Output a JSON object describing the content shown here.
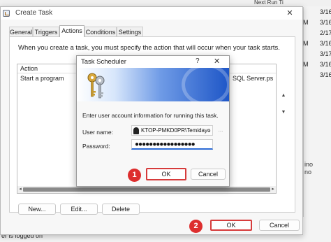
{
  "background": {
    "next_run_header": "Next Run Ti",
    "rows": [
      {
        "marker": "",
        "value": "3/16"
      },
      {
        "marker": "M",
        "value": "3/16"
      },
      {
        "marker": "",
        "value": "2/17"
      },
      {
        "marker": "M",
        "value": "3/16"
      },
      {
        "marker": "",
        "value": "3/17"
      },
      {
        "marker": "M",
        "value": "3/16"
      },
      {
        "marker": "",
        "value": "3/16"
      }
    ],
    "status_text": "er is logged on",
    "side_text": "ino",
    "side_text_2": "no"
  },
  "create_task": {
    "title": "Create Task",
    "close_glyph": "✕",
    "tabs": [
      {
        "label": "General"
      },
      {
        "label": "Triggers"
      },
      {
        "label": "Actions"
      },
      {
        "label": "Conditions"
      },
      {
        "label": "Settings"
      }
    ],
    "active_tab": "Actions",
    "intro": "When you create a task, you must specify the action that will occur when your task starts.",
    "list_header": "Action",
    "list_rows": [
      {
        "action": "Start a program",
        "details": "SQL Server.ps"
      }
    ],
    "buttons": {
      "new": "New...",
      "edit": "Edit...",
      "delete": "Delete",
      "ok": "OK",
      "cancel": "Cancel"
    },
    "step_markers": {
      "one": "1",
      "two": "2"
    }
  },
  "credentials_dialog": {
    "title": "Task Scheduler",
    "help_glyph": "?",
    "close_glyph": "✕",
    "description": "Enter user account information for running this task.",
    "user_label": "User name:",
    "user_value": "KTOP-PMKD0PR\\Temidayo",
    "password_label": "Password:",
    "password_value": "●●●●●●●●●●●●●●●●●",
    "browse_label": "...",
    "ok_label": "OK",
    "cancel_label": "Cancel"
  },
  "colors": {
    "highlight_red": "#d63b3b",
    "banner_blue": "#1e56c7",
    "focus_blue": "#2d6bd6"
  }
}
